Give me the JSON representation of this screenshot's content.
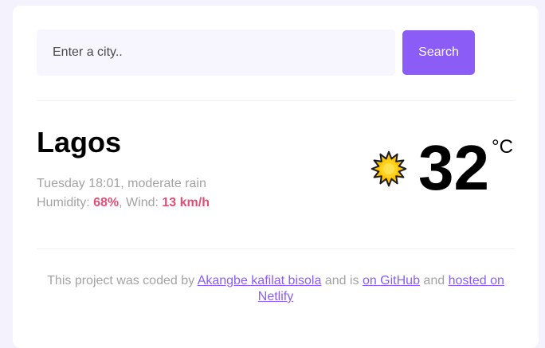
{
  "search": {
    "placeholder": "Enter a city..",
    "button_label": "Search"
  },
  "current": {
    "city": "Lagos",
    "datetime": "Tuesday 18:01",
    "description": "moderate rain",
    "humidity_label": "Humidity: ",
    "humidity_value": "68%",
    "wind_label": "Wind: ",
    "wind_value": "13 km/h",
    "icon": "sun-icon",
    "temperature": "32",
    "unit": "°C"
  },
  "footer": {
    "text_1": "This project was coded by ",
    "author_link": "Akangbe kafilat bisola",
    "text_2": " and is ",
    "github_link": "on GitHub",
    "text_3": " and ",
    "netlify_link": "hosted on Netlify"
  },
  "colors": {
    "accent": "#8b5cf6",
    "highlight": "#e34e76",
    "page_background": "#f4f2fc",
    "input_background": "#f7f5fe",
    "muted_text": "#a3a3a3"
  }
}
